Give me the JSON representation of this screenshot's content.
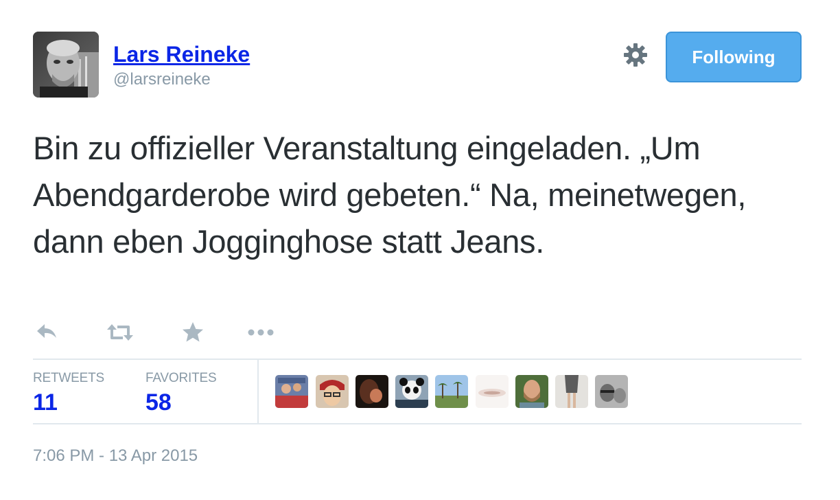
{
  "user": {
    "display_name": "Lars Reineke",
    "screen_name": "@larsreineke"
  },
  "follow_button": {
    "label": "Following"
  },
  "tweet": {
    "text": "Bin zu offizieller Veranstaltung eingeladen. „Um Abendgarderobe wird gebeten.“ Na, meinetwegen, dann eben Jogginghose statt Jeans.",
    "timestamp": "7:06 PM - 13 Apr 2015"
  },
  "actions": {
    "icons": [
      "reply-icon",
      "retweet-icon",
      "favorite-icon",
      "more-icon"
    ]
  },
  "stats": {
    "retweets_label": "RETWEETS",
    "retweets_count": "11",
    "favorites_label": "FAVORITES",
    "favorites_count": "58"
  },
  "favoriter_avatars": [
    "favoriter-avatar-1",
    "favoriter-avatar-2",
    "favoriter-avatar-3",
    "favoriter-avatar-4",
    "favoriter-avatar-5",
    "favoriter-avatar-6",
    "favoriter-avatar-7",
    "favoriter-avatar-8",
    "favoriter-avatar-9"
  ],
  "colors": {
    "accent": "#55acee",
    "link": "#0b26e6",
    "muted": "#8899a6",
    "text": "#292f33",
    "divider": "#e1e8ed",
    "icon": "#aab8c2"
  }
}
